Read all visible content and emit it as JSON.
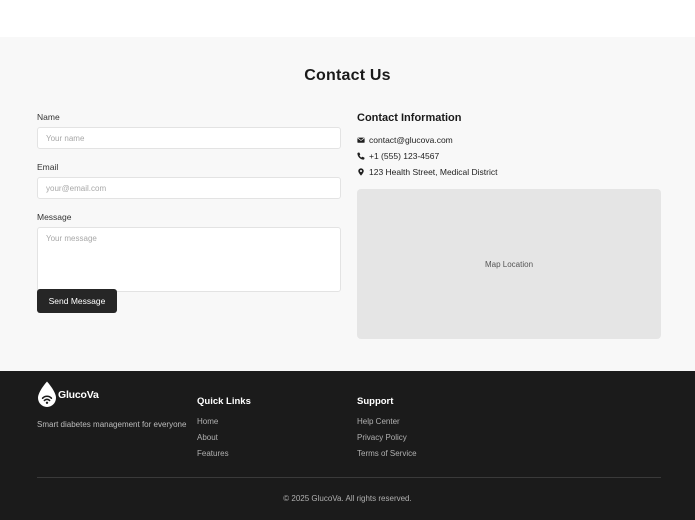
{
  "contact": {
    "title": "Contact Us",
    "form": {
      "name_label": "Name",
      "name_placeholder": "Your name",
      "email_label": "Email",
      "email_placeholder": "your@email.com",
      "message_label": "Message",
      "message_placeholder": "Your message",
      "submit_label": "Send Message"
    },
    "info": {
      "heading": "Contact Information",
      "email": "contact@glucova.com",
      "phone": "+1 (555) 123-4567",
      "address": "123 Health Street, Medical District",
      "map_label": "Map Location"
    }
  },
  "footer": {
    "brand_name": "GlucoVa",
    "tagline": "Smart diabetes management for everyone",
    "quick_links": {
      "title": "Quick Links",
      "items": [
        "Home",
        "About",
        "Features"
      ]
    },
    "support": {
      "title": "Support",
      "items": [
        "Help Center",
        "Privacy Policy",
        "Terms of Service"
      ]
    },
    "copyright": "© 2025 GlucoVa. All rights reserved."
  },
  "icons": {
    "email": "envelope-icon",
    "phone": "phone-icon",
    "address": "map-pin-icon",
    "logo": "drop-logo-icon"
  },
  "colors": {
    "section_bg": "#f8f8f8",
    "button_bg": "#262626",
    "footer_bg": "#1b1b1b",
    "map_bg": "#e5e5e5"
  }
}
